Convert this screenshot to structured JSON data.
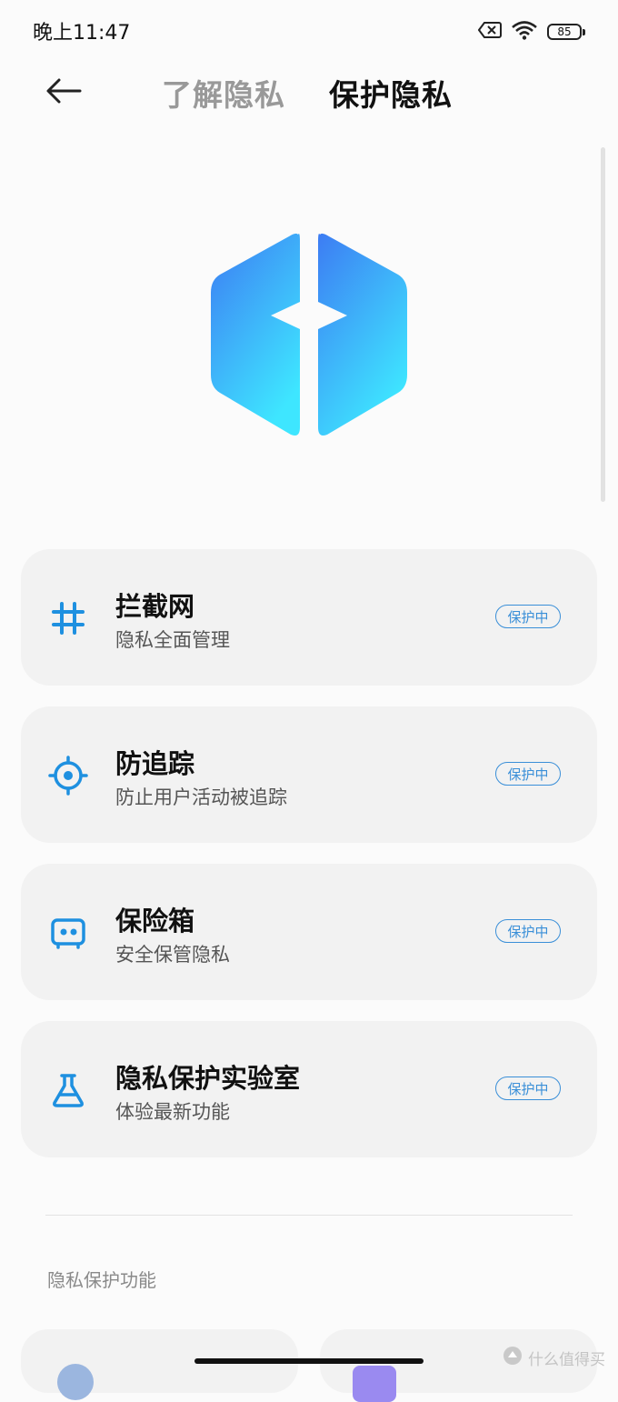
{
  "status_bar": {
    "time": "晚上11:47",
    "battery_level": "85",
    "icons": [
      "sim-off-icon",
      "wifi-icon",
      "battery-icon"
    ]
  },
  "header": {
    "back_icon": "arrow-left-icon",
    "tabs": [
      {
        "label": "了解隐私",
        "active": false
      },
      {
        "label": "保护隐私",
        "active": true
      }
    ]
  },
  "colors": {
    "accent": "#3a8fd8",
    "card_bg": "#f2f2f2",
    "logo_gradient_top": "#3d7cf3",
    "logo_gradient_bottom": "#3ee6ff"
  },
  "cards": [
    {
      "icon": "hash-icon",
      "title": "拦截网",
      "subtitle": "隐私全面管理",
      "badge": "保护中"
    },
    {
      "icon": "target-icon",
      "title": "防追踪",
      "subtitle": "防止用户活动被追踪",
      "badge": "保护中"
    },
    {
      "icon": "safe-box-icon",
      "title": "保险箱",
      "subtitle": "安全保管隐私",
      "badge": "保护中"
    },
    {
      "icon": "flask-icon",
      "title": "隐私保护实验室",
      "subtitle": "体验最新功能",
      "badge": "保护中"
    }
  ],
  "section_title": "隐私保护功能",
  "watermark": "什么值得买"
}
